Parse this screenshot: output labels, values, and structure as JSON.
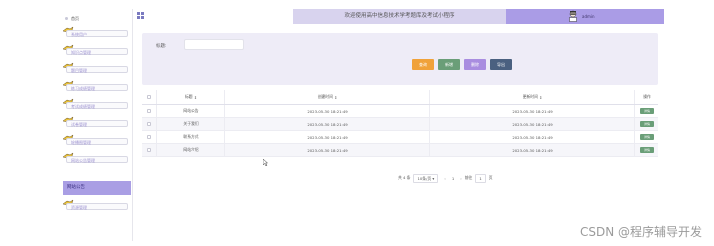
{
  "app": {
    "title": "欢迎使用高中信息技术学考题库及考试小程序",
    "user_name": "admin"
  },
  "sidebar": {
    "home_label": "首页",
    "items": [
      {
        "label": "系统用户"
      },
      {
        "label": "知识点管理"
      },
      {
        "label": "题目管理"
      },
      {
        "label": "练习成绩管理"
      },
      {
        "label": "考试成绩管理"
      },
      {
        "label": "试卷管理"
      },
      {
        "label": "轮播图管理"
      },
      {
        "label": "网站公告管理"
      },
      {
        "label": "网站公告"
      },
      {
        "label": "资源管理"
      }
    ],
    "active_index": 8
  },
  "search": {
    "label": "标题:",
    "value": "",
    "placeholder": ""
  },
  "buttons": {
    "search": {
      "label": "查询",
      "color": "#f0a23a"
    },
    "add": {
      "label": "新增",
      "color": "#6a9e78"
    },
    "delete": {
      "label": "删除",
      "color": "#a98de0"
    },
    "export": {
      "label": "导出",
      "color": "#4a6080"
    }
  },
  "table": {
    "headers": [
      "标题",
      "创建时间",
      "更新时间",
      "操作"
    ],
    "rows": [
      {
        "title": "网站公告",
        "created": "2023-05-30 18:21:49",
        "updated": "2023-05-30 18:21:49",
        "action": "详情"
      },
      {
        "title": "关于我们",
        "created": "2023-05-30 18:21:49",
        "updated": "2023-05-30 18:21:49",
        "action": "详情"
      },
      {
        "title": "联系方式",
        "created": "2023-05-30 18:21:49",
        "updated": "2023-05-30 18:21:49",
        "action": "详情"
      },
      {
        "title": "网站介绍",
        "created": "2023-05-30 18:21:49",
        "updated": "2023-05-30 18:21:49",
        "action": "详情"
      }
    ]
  },
  "pagination": {
    "total": "共 4 条",
    "page_size": "10条/页",
    "prev": "‹",
    "current": "1",
    "next": "›",
    "goto_label": "前往",
    "goto_value": "1",
    "page_unit": "页"
  },
  "watermark": "CSDN @程序辅导开发"
}
